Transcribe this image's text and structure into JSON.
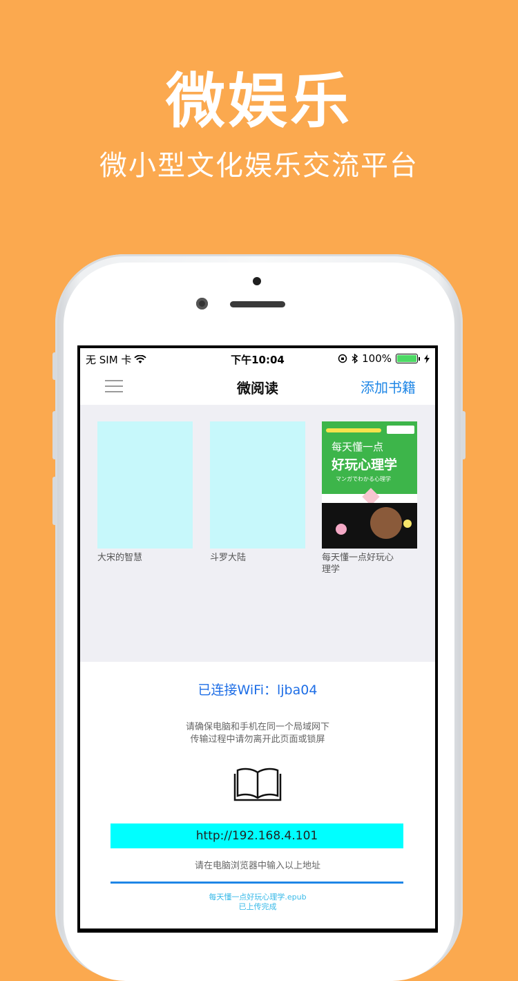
{
  "promo": {
    "title": "微娱乐",
    "subtitle": "微小型文化娱乐交流平台"
  },
  "status_bar": {
    "carrier": "无 SIM 卡",
    "time": "下午10:04",
    "battery": "100%"
  },
  "nav": {
    "title": "微阅读",
    "action": "添加书籍"
  },
  "books": [
    {
      "title": "大宋的智慧"
    },
    {
      "title": "斗罗大陆"
    },
    {
      "title": "每天懂一点好玩心理学",
      "cover": {
        "line1": "每天懂一点",
        "line2": "好玩心理学",
        "line3": "マンガでわかる心理学"
      }
    }
  ],
  "wifi": {
    "connected": "已连接WiFi：ljba04",
    "tip_line1": "请确保电脑和手机在同一个局域网下",
    "tip_line2": "传输过程中请勿离开此页面或锁屏",
    "url": "http://192.168.4.101",
    "url_hint": "请在电脑浏览器中输入以上地址",
    "progress": 1.0,
    "uploaded_file": "每天懂一点好玩心理学.epub",
    "upload_status": "已上传完成"
  },
  "colors": {
    "background": "#FBA94F",
    "accent": "#1E86E6",
    "shelf": "#EFEFF4",
    "placeholder_cover": "#C7F8FB",
    "url_box": "#00FFFF"
  }
}
